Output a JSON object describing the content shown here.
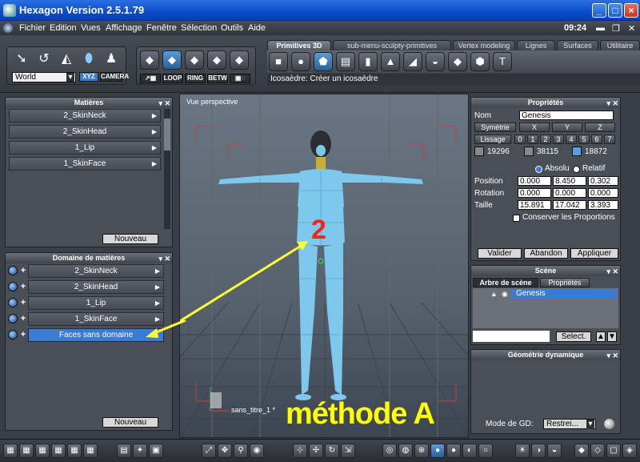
{
  "window": {
    "title": "Hexagon Version 2.5.1.79",
    "minimize": "_",
    "maximize": "□",
    "close": "×"
  },
  "menu": [
    "Fichier",
    "Edition",
    "Vues",
    "Affichage",
    "Fenêtre",
    "Sélection",
    "Outils",
    "Aide"
  ],
  "clock": "09:24",
  "tabs": [
    "Primitives 3D",
    "sub-menu-sculpty-primitives",
    "Vertex modeling",
    "Lignes",
    "Surfaces",
    "Utilitaire"
  ],
  "tool_hint": "Icosaèdre: Créer un icosaèdre",
  "coord_system": {
    "value": "World",
    "xyz": "XYZ",
    "camera": "CAMERA"
  },
  "selection_modes": [
    "LOOP",
    "RING",
    "BETW"
  ],
  "materials_panel": {
    "title": "Matières",
    "items": [
      "2_SkinNeck",
      "2_SkinHead",
      "1_Lip",
      "1_SkinFace"
    ],
    "new_button": "Nouveau"
  },
  "domains_panel": {
    "title": "Domaine de matières",
    "items": [
      "2_SkinNeck",
      "2_SkinHead",
      "1_Lip",
      "1_SkinFace",
      "Faces sans domaine"
    ],
    "selected_index": 4,
    "new_button": "Nouveau"
  },
  "viewport": {
    "label": "Vue perspective",
    "file_label": "sans_titre_1 *",
    "annotation_number": "2",
    "annotation_text": "méthode A",
    "colors": {
      "annotation_number": "#ff2020",
      "annotation_text": "#ffff00",
      "arrow": "#ffff30",
      "mesh": "#7ec8ee"
    }
  },
  "properties_panel": {
    "title": "Propriétés",
    "name_label": "Nom",
    "name_value": "Genesis",
    "symmetry_label": "Symétrie",
    "axes": [
      "X",
      "Y",
      "Z"
    ],
    "smoothing_label": "Lissage",
    "smoothing_levels": [
      "0",
      "1",
      "2",
      "3",
      "4",
      "5",
      "6",
      "7"
    ],
    "counts": [
      "19296",
      "38115",
      "18872"
    ],
    "absolute_label": "Absolu",
    "relative_label": "Relatif",
    "position_label": "Position",
    "position": [
      "0.000",
      "8.450",
      "0.302"
    ],
    "rotation_label": "Rotation",
    "rotation": [
      "0.000",
      "0.000",
      "0.000"
    ],
    "size_label": "Taille",
    "size": [
      "15.891",
      "17.042",
      "3.393"
    ],
    "keep_proportions": "Conserver les Proportions",
    "validate": "Valider",
    "cancel": "Abandon",
    "apply": "Appliquer"
  },
  "scene_panel": {
    "title": "Scène",
    "tab_tree": "Arbre de scène",
    "tab_props": "Propriétés",
    "item": "Genesis",
    "select_button": "Select."
  },
  "dynamic_panel": {
    "title": "Géométrie dynamique",
    "mode_label": "Mode de GD:",
    "mode_value": "Restrei..."
  }
}
